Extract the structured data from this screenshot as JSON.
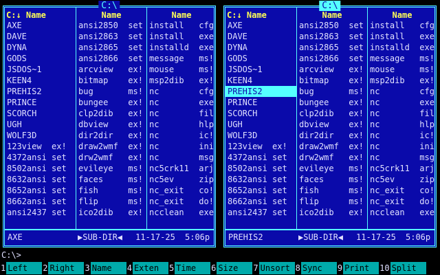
{
  "left_panel": {
    "title": "C:\\",
    "headers": [
      "C:↓ Name",
      "Name",
      "Name"
    ],
    "columns": [
      [
        "AXE",
        "DAVE",
        "DYNA",
        "GODS",
        "JSDOS~1",
        "KEEN4",
        "PREHIS2",
        "PRINCE",
        "SCORCH",
        "UGH",
        "WOLF3D",
        "123view  ex!",
        "4372ansi set",
        "8502ansi set",
        "8632ansi set",
        "8652ansi set",
        "8662ansi set",
        "ansi2437 set"
      ],
      [
        "ansi2850  set",
        "ansi2863  set",
        "ansi2865  set",
        "ansi2866  set",
        "arcview   ex!",
        "bitmap    ex!",
        "bug       ms!",
        "bungee    ex!",
        "clp2dib   ex!",
        "dbview    ex!",
        "dir2dir   ex!",
        "draw2wmf  ex!",
        "drw2wmf   ex!",
        "evileye   ms!",
        "faces     ms!",
        "fish      ms!",
        "flip      ms!",
        "ico2dib   ex!"
      ],
      [
        "install   cfg",
        "install   exe",
        "installd  exe",
        "message   ms!",
        "mouse     ms!",
        "msp2dib   ex!",
        "nc        cfg",
        "nc        exe",
        "nc        fil",
        "nc        hlp",
        "nc        ic!",
        "nc        ini",
        "nc        msg",
        "nc5crk11  arj",
        "nc5ev     zip",
        "nc_exit   co!",
        "nc_exit   do!",
        "ncclean   exe"
      ]
    ],
    "status": {
      "name": "AXE",
      "type": "▶SUB-DIR◀",
      "date": "11-17-25",
      "time": "5:06p"
    }
  },
  "right_panel": {
    "title": "C:\\",
    "headers": [
      "C:↓ Name",
      "Name",
      "Name"
    ],
    "columns": [
      [
        "AXE",
        "DAVE",
        "DYNA",
        "GODS",
        "JSDOS~1",
        "KEEN4",
        "PREHIS2",
        "PRINCE",
        "SCORCH",
        "UGH",
        "WOLF3D",
        "123view  ex!",
        "4372ansi set",
        "8502ansi set",
        "8632ansi set",
        "8652ansi set",
        "8662ansi set",
        "ansi2437 set"
      ],
      [
        "ansi2850  set",
        "ansi2863  set",
        "ansi2865  set",
        "ansi2866  set",
        "arcview   ex!",
        "bitmap    ex!",
        "bug       ms!",
        "bungee    ex!",
        "clp2dib   ex!",
        "dbview    ex!",
        "dir2dir   ex!",
        "draw2wmf  ex!",
        "drw2wmf   ex!",
        "evileye   ms!",
        "faces     ms!",
        "fish      ms!",
        "flip      ms!",
        "ico2dib   ex!"
      ],
      [
        "install   cfg",
        "install   exe",
        "installd  exe",
        "message   ms!",
        "mouse     ms!",
        "msp2dib   ex!",
        "nc        cfg",
        "nc        exe",
        "nc        fil",
        "nc        hlp",
        "nc        ic!",
        "nc        ini",
        "nc        msg",
        "nc5crk11  arj",
        "nc5ev     zip",
        "nc_exit   co!",
        "nc_exit   do!",
        "ncclean   exe"
      ]
    ],
    "selected": "PREHIS2",
    "status": {
      "name": "PREHIS2",
      "type": "▶SUB-DIR◀",
      "date": "11-17-25",
      "time": "5:06p"
    }
  },
  "command_line": "C:\\>",
  "function_keys": [
    {
      "num": "1",
      "label": "Left"
    },
    {
      "num": "2",
      "label": "Right"
    },
    {
      "num": "3",
      "label": "Name"
    },
    {
      "num": "4",
      "label": "Exten"
    },
    {
      "num": "5",
      "label": "Time"
    },
    {
      "num": "6",
      "label": "Size"
    },
    {
      "num": "7",
      "label": "Unsort"
    },
    {
      "num": "8",
      "label": "Sync"
    },
    {
      "num": "9",
      "label": "Print"
    },
    {
      "num": "10",
      "label": "Split"
    }
  ],
  "colors": {
    "panel_bg": "#0a0aaa",
    "frame": "#55ffff",
    "header": "#ffff55",
    "fkey_bg": "#00aaaa"
  }
}
